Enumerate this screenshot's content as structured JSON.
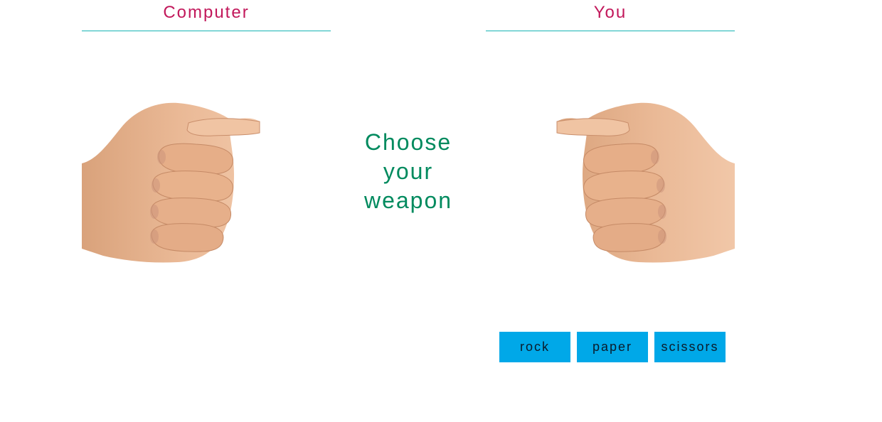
{
  "players": {
    "computer": "Computer",
    "you": "You"
  },
  "prompt": {
    "line1": "Choose",
    "line2": "your",
    "line3": "weapon"
  },
  "weapons": {
    "rock": "rock",
    "paper": "paper",
    "scissors": "scissors"
  },
  "colors": {
    "title": "#c2185b",
    "divider": "#17b3b3",
    "prompt": "#008a5e",
    "button": "#00a8e8",
    "skin": "#e8b48f"
  },
  "hands": {
    "computer": "rock-fist-icon",
    "player": "rock-fist-icon"
  }
}
